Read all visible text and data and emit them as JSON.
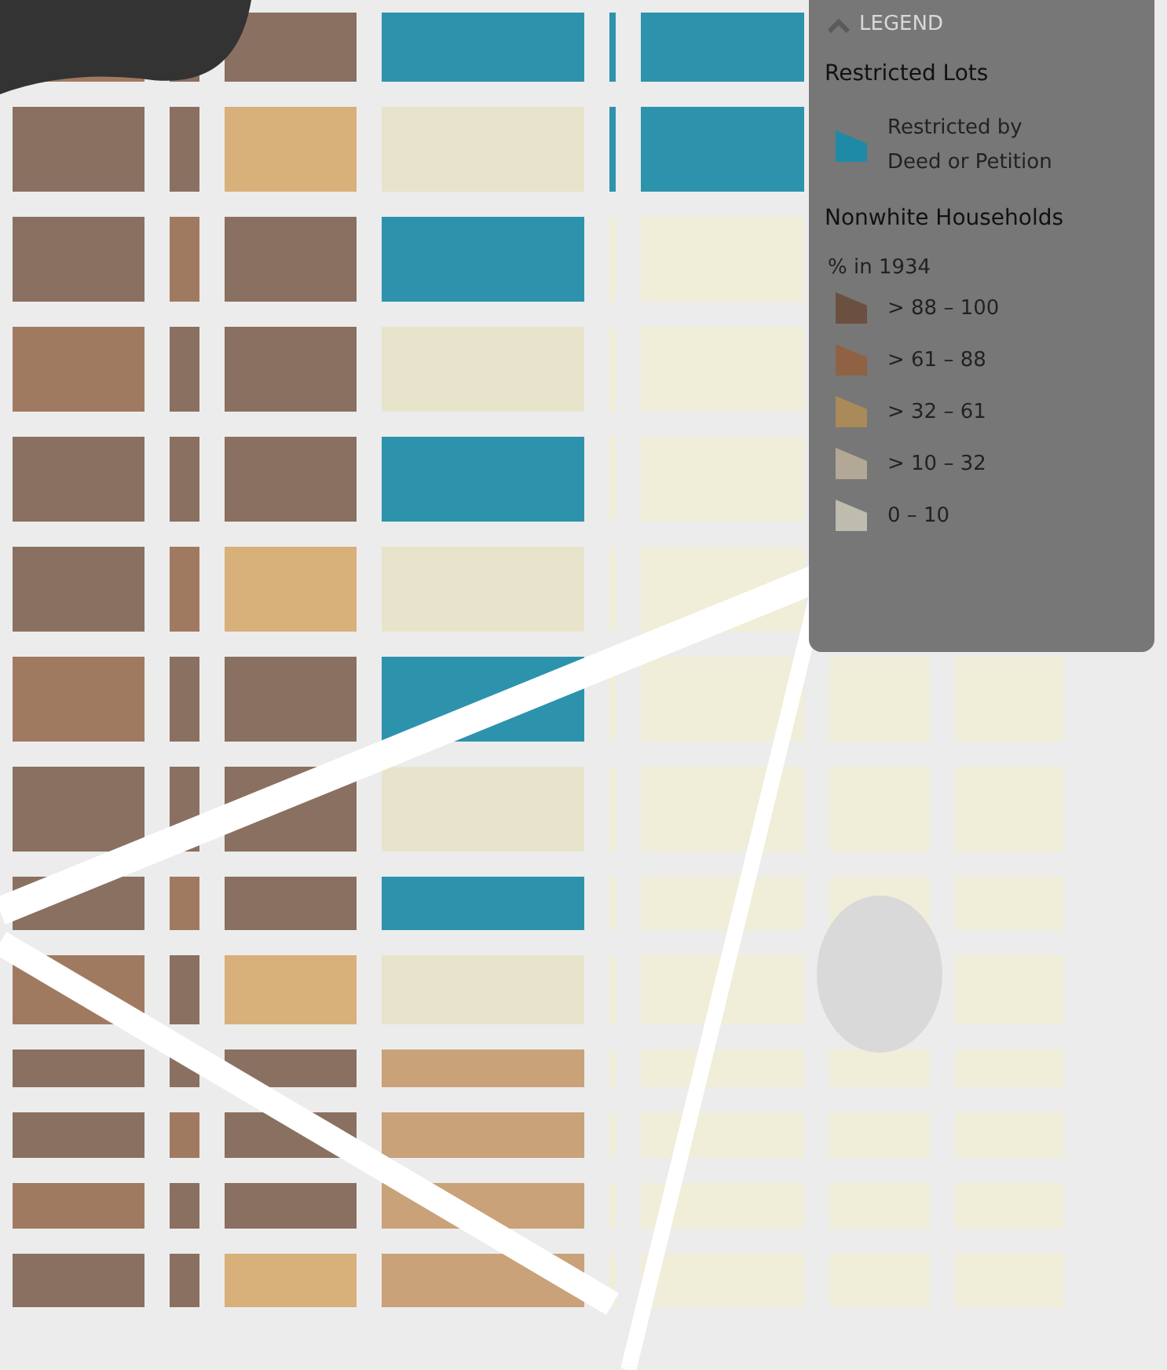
{
  "legend": {
    "title": "LEGEND",
    "expanded": true,
    "sections": [
      {
        "heading": "Restricted Lots",
        "items": [
          {
            "label": "Restricted by Deed or Petition",
            "color": "#1f8aa5"
          }
        ]
      },
      {
        "heading": "Nonwhite Households",
        "subheading": "% in 1934",
        "items": [
          {
            "label": "> 88 – 100",
            "color": "#6b5040"
          },
          {
            "label": "> 61 – 88",
            "color": "#8f6243"
          },
          {
            "label": "> 32 – 61",
            "color": "#a98a58"
          },
          {
            "label": "> 10 – 32",
            "color": "#b3a796"
          },
          {
            "label": "0 – 10",
            "color": "#bdbcae"
          }
        ]
      }
    ]
  }
}
